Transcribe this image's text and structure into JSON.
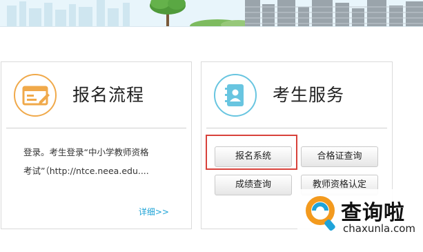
{
  "cards": [
    {
      "title": "报名流程",
      "icon": "registration-form-icon",
      "description_lines": [
        "登录。考生登录“中小学教师资格",
        "考试”（http://ntce.neea.edu...."
      ],
      "more_link": "详细>>"
    },
    {
      "title": "考生服务",
      "icon": "address-book-icon",
      "buttons": [
        "报名系统",
        "合格证查询",
        "成绩查询",
        "教师资格认定"
      ]
    }
  ],
  "watermark": {
    "brand": "查询啦",
    "url": "chaxunla.com",
    "logo_icon": "magnifier-logo-icon"
  },
  "colors": {
    "orange_accent": "#f0a94a",
    "blue_accent": "#68c5e0",
    "link": "#1ea3d6",
    "highlight_box": "#d8413a",
    "watermark_orange": "#f39a1e",
    "watermark_blue": "#1fa3d9"
  }
}
